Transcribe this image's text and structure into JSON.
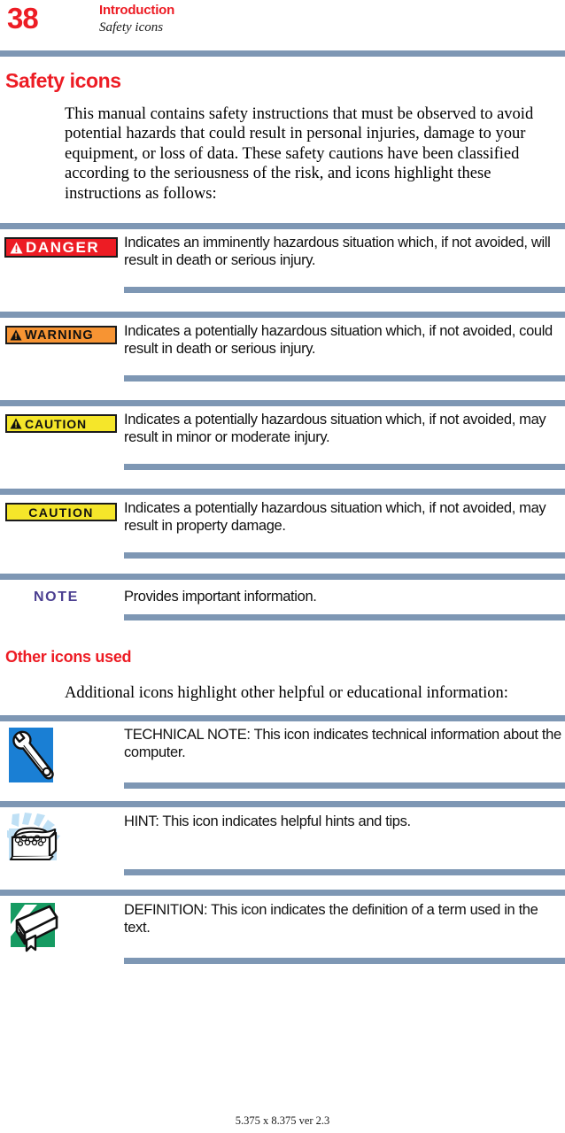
{
  "header": {
    "page_number": "38",
    "chapter": "Introduction",
    "section": "Safety icons"
  },
  "sections": {
    "safety_icons_heading": "Safety icons",
    "safety_intro": "This manual contains safety instructions that must be observed to avoid potential hazards that could result in personal injuries, damage to your equipment, or loss of data. These safety cautions have been classified according to the seriousness of the risk, and icons highlight these instructions as follows:",
    "other_icons_heading": "Other icons used",
    "other_intro": "Additional icons highlight other helpful or educational information:"
  },
  "safety_rows": [
    {
      "badge_label": "DANGER",
      "badge_kind": "danger",
      "has_triangle": true,
      "description": "Indicates an imminently hazardous situation which, if not avoided, will result in death or serious injury."
    },
    {
      "badge_label": "WARNING",
      "badge_kind": "warning",
      "has_triangle": true,
      "description": "Indicates a potentially hazardous situation which, if not avoided, could result in death or serious injury."
    },
    {
      "badge_label": "CAUTION",
      "badge_kind": "caution",
      "has_triangle": true,
      "description": "Indicates a potentially hazardous situation which, if not avoided, may result in minor or moderate injury."
    },
    {
      "badge_label": "CAUTION",
      "badge_kind": "caution-plain",
      "has_triangle": false,
      "description": "Indicates a potentially hazardous situation which, if not avoided, may result in property damage."
    },
    {
      "badge_label": "NOTE",
      "badge_kind": "note",
      "has_triangle": false,
      "description": "Provides important information."
    }
  ],
  "other_rows": [
    {
      "icon_name": "wrench-icon",
      "description": "TECHNICAL NOTE: This icon indicates technical information about the computer."
    },
    {
      "icon_name": "treasure-chest-icon",
      "description": "HINT: This icon indicates helpful hints and tips."
    },
    {
      "icon_name": "book-icon",
      "description": "DEFINITION: This icon indicates the definition of a term used in the text."
    }
  ],
  "footer": {
    "text": "5.375 x 8.375 ver 2.3"
  },
  "colors": {
    "accent_red": "#ed1c24",
    "rule_blue": "#7e97b4",
    "note_purple": "#4b3f91",
    "danger_red": "#ed1c24",
    "warning_orange": "#f79433",
    "caution_yellow": "#f5e62a",
    "tech_blue": "#1a7fd4",
    "definition_green": "#169b62",
    "hint_blue": "#bfe0f5"
  }
}
